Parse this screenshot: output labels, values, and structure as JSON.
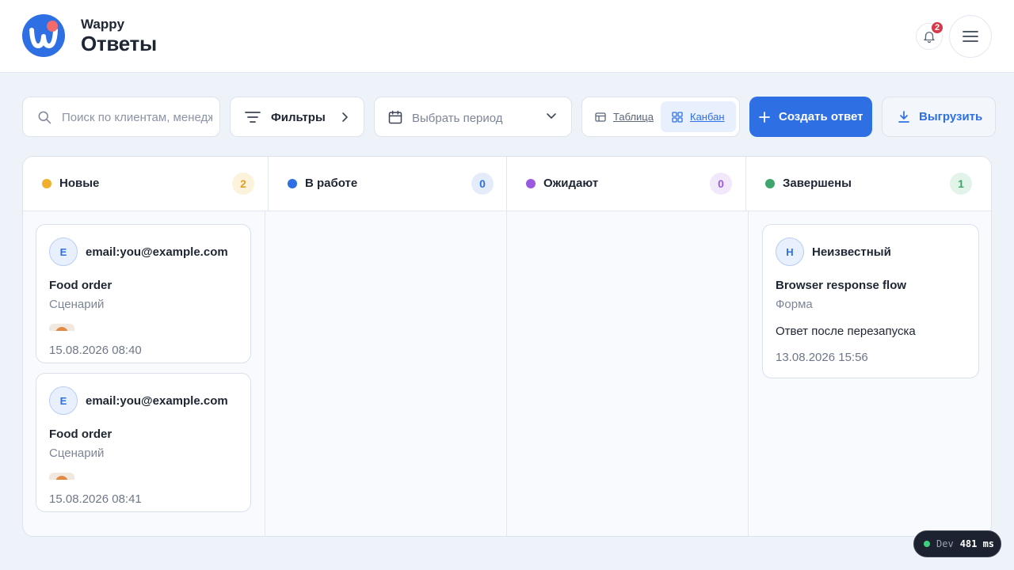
{
  "app": {
    "name": "Wappy",
    "page_title": "Ответы",
    "notifications_count": "2"
  },
  "toolbar": {
    "search_placeholder": "Поиск по клиентам, менеджерам",
    "filters_label": "Фильтры",
    "period_label": "Выбрать период",
    "view_table_label": "Таблица",
    "view_kanban_label": "Канбан",
    "active_view": "Канбан",
    "create_label": "Создать ответ",
    "export_label": "Выгрузить"
  },
  "colors": {
    "accent": "#2f6fe4",
    "new": "#f0b02c",
    "in_progress": "#2f6fe4",
    "waiting": "#9a5ae0",
    "done": "#3ea66b"
  },
  "columns": [
    {
      "name": "Новые",
      "count": "2",
      "cards": [
        {
          "avatar": "E",
          "client": "email:you@example.com",
          "title": "Food order",
          "type": "Сценарий",
          "date": "15.08.2026 08:40"
        },
        {
          "avatar": "E",
          "client": "email:you@example.com",
          "title": "Food order",
          "type": "Сценарий",
          "date": "15.08.2026 08:41"
        }
      ]
    },
    {
      "name": "В работе",
      "count": "0",
      "cards": []
    },
    {
      "name": "Ожидают",
      "count": "0",
      "cards": []
    },
    {
      "name": "Завершены",
      "count": "1",
      "cards": [
        {
          "avatar": "Н",
          "client": "Неизвестный",
          "title": "Browser response flow",
          "type": "Форма",
          "comment": "Ответ после перезапуска",
          "date": "13.08.2026 15:56"
        }
      ]
    }
  ],
  "dev": {
    "env": "Dev",
    "latency": "481 ms"
  }
}
